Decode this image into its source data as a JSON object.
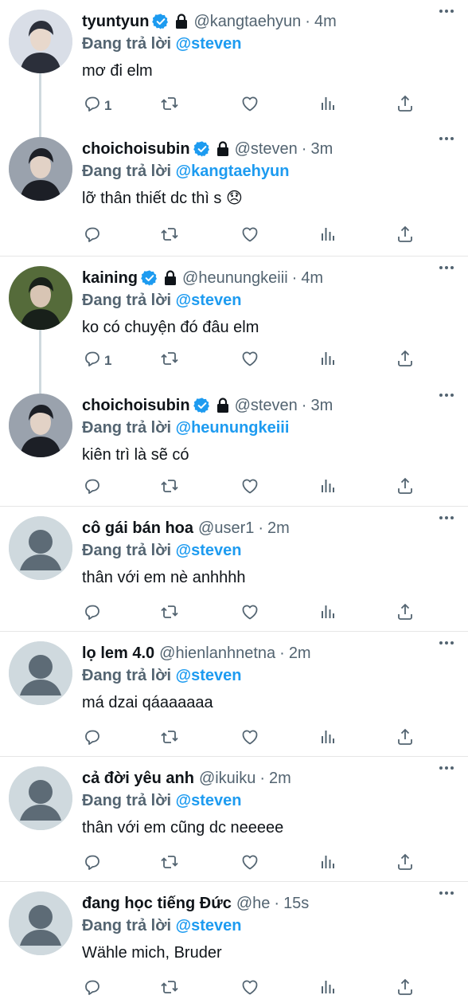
{
  "colors": {
    "accent": "#1d9bf0",
    "secondary": "#536471",
    "text": "#0f1419"
  },
  "tweets": [
    {
      "name": "tyuntyun",
      "verified": true,
      "locked": true,
      "handle": "@kangtaehyun",
      "dot": "·",
      "time": "4m",
      "replying_prefix": "Đang trả lời",
      "replying_to": "@steven",
      "text": "mơ đi elm",
      "reply_count": "1",
      "avatar": "photo"
    },
    {
      "name": "choichoisubin",
      "verified": true,
      "locked": true,
      "handle": "@steven",
      "dot": "·",
      "time": "3m",
      "replying_prefix": "Đang trả lời",
      "replying_to": "@kangtaehyun",
      "text": "lỡ thân thiết dc thì s 😞",
      "reply_count": "",
      "avatar": "photo"
    },
    {
      "name": "kaining",
      "verified": true,
      "locked": true,
      "handle": "@heunungkeiii",
      "dot": "·",
      "time": "4m",
      "replying_prefix": "Đang trả lời",
      "replying_to": "@steven",
      "text": "ko có chuyện đó đâu elm",
      "reply_count": "1",
      "avatar": "photo"
    },
    {
      "name": "choichoisubin",
      "verified": true,
      "locked": true,
      "handle": "@steven",
      "dot": "·",
      "time": "3m",
      "replying_prefix": "Đang trả lời",
      "replying_to": "@heunungkeiii",
      "text": "kiên trì là sẽ có",
      "reply_count": "",
      "avatar": "photo"
    },
    {
      "name": "cô gái bán hoa",
      "verified": false,
      "locked": false,
      "handle": "@user1",
      "dot": "·",
      "time": "2m",
      "replying_prefix": "Đang trả lời",
      "replying_to": "@steven",
      "text": "thân với em nè anhhhh",
      "reply_count": "",
      "avatar": "default"
    },
    {
      "name": "lọ lem 4.0",
      "verified": false,
      "locked": false,
      "handle": "@hienlanhnetna",
      "dot": "·",
      "time": "2m",
      "replying_prefix": "Đang trả lời",
      "replying_to": "@steven",
      "text": "má dzai qáaaaaaa",
      "reply_count": "",
      "avatar": "default"
    },
    {
      "name": "cả đời yêu anh",
      "verified": false,
      "locked": false,
      "handle": "@ikuiku",
      "dot": "·",
      "time": "2m",
      "replying_prefix": "Đang trả lời",
      "replying_to": "@steven",
      "text": "thân với em cũng dc neeeee",
      "reply_count": "",
      "avatar": "default"
    },
    {
      "name": "đang học tiếng Đức",
      "verified": false,
      "locked": false,
      "handle": "@he",
      "dot": "·",
      "time": "15s",
      "replying_prefix": "Đang trả lời",
      "replying_to": "@steven",
      "text": "Wähle mich, Bruder",
      "reply_count": "",
      "avatar": "default"
    }
  ],
  "icons": {
    "reply": "reply-icon",
    "retweet": "retweet-icon",
    "like": "heart-icon",
    "views": "views-icon",
    "share": "share-icon",
    "more": "more-icon",
    "verified": "verified-badge-icon",
    "lock": "lock-icon"
  }
}
